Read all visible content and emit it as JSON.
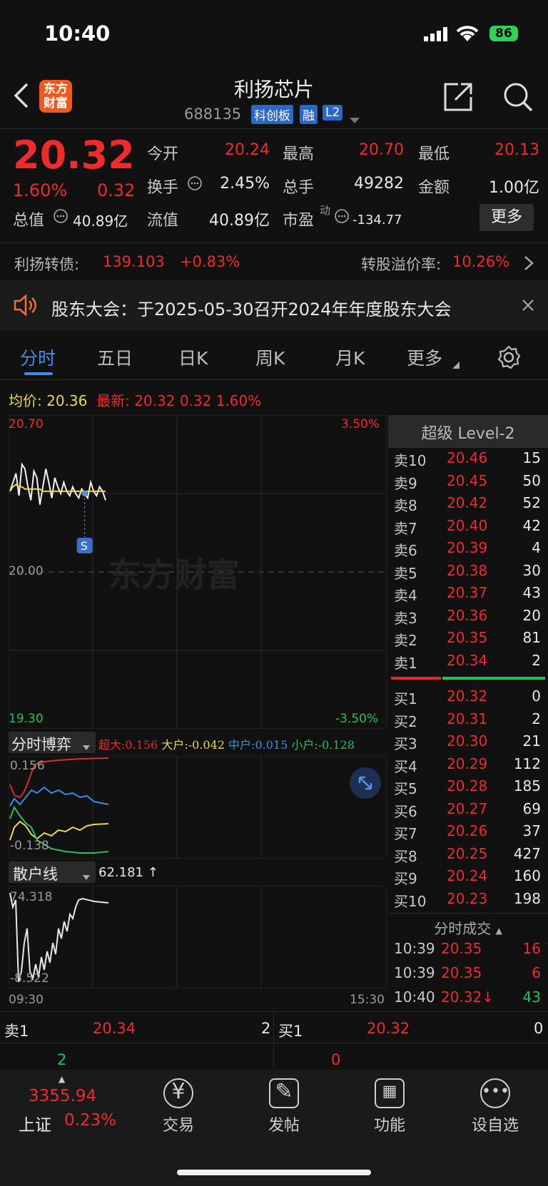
{
  "status_bar": {
    "time": "10:40",
    "battery": "86"
  },
  "header": {
    "logo_line1": "东方",
    "logo_line2": "财富",
    "title": "利扬芯片",
    "code": "688135",
    "tags": [
      "科创板",
      "融",
      "L2"
    ]
  },
  "quote": {
    "price": "20.32",
    "change_pct": "1.60%",
    "change": "0.32",
    "open_label": "今开",
    "open": "20.24",
    "high_label": "最高",
    "high": "20.70",
    "low_label": "最低",
    "low": "20.13",
    "turnover_label": "换手",
    "turnover": "2.45%",
    "volume_label": "总手",
    "volume": "49282",
    "amount_label": "金额",
    "amount": "1.00亿",
    "mktcap_label": "总值",
    "mktcap": "40.89亿",
    "float_label": "流值",
    "float": "40.89亿",
    "pe_label": "市盈",
    "pe_sup": "动",
    "pe": "-134.77",
    "more": "更多"
  },
  "bond": {
    "label": "利扬转债:",
    "price": "139.103",
    "change": "+0.83%",
    "premium_label": "转股溢价率:",
    "premium": "10.26%"
  },
  "notice": {
    "text": "股东大会：于2025-05-30召开2024年年度股东大会"
  },
  "tabs": [
    "分时",
    "五日",
    "日K",
    "周K",
    "月K",
    "更多"
  ],
  "chart_info": {
    "avg_label": "均价:",
    "avg": "20.36",
    "last_label": "最新:",
    "last": "20.32",
    "chg": "0.32",
    "pct": "1.60%"
  },
  "chart_data": [
    {
      "type": "line",
      "y_max_label": "20.70",
      "y_mid_label": "20.00",
      "y_min_label": "19.30",
      "pct_max_label": "3.50%",
      "pct_min_label": "-3.50%",
      "x_start": "09:30",
      "x_end": "15:30",
      "ylim": [
        19.3,
        20.7
      ],
      "series": [
        {
          "values": [
            20.36,
            20.4,
            20.44,
            20.34,
            20.48,
            20.46,
            20.38,
            20.32,
            20.45,
            20.42,
            20.3,
            20.38,
            20.46,
            20.4,
            20.33,
            20.42,
            20.38,
            20.35,
            20.4,
            20.36,
            20.34,
            20.38,
            20.35,
            20.33,
            20.37,
            20.35,
            20.33,
            20.4,
            20.36,
            20.34,
            20.38,
            20.36,
            20.32
          ]
        },
        {
          "values": [
            20.36,
            20.38,
            20.39,
            20.38,
            20.38,
            20.37,
            20.37,
            20.37,
            20.37,
            20.37,
            20.37,
            20.36,
            20.36,
            20.36,
            20.36,
            20.36,
            20.36,
            20.36,
            20.36,
            20.36,
            20.36,
            20.36,
            20.36,
            20.36,
            20.36,
            20.36,
            20.36,
            20.36,
            20.36,
            20.36,
            20.36,
            20.36,
            20.36
          ]
        }
      ],
      "marker": "S"
    }
  ],
  "game": {
    "title": "分时博弈",
    "super_label": "超大:",
    "super": "0.156",
    "big_label": "大户:",
    "big": "-0.042",
    "mid_label": "中户:",
    "mid": "0.015",
    "small_label": "小户:",
    "small": "-0.128",
    "y_max": "0.156",
    "y_min": "-0.138"
  },
  "retail": {
    "title": "散户线",
    "value": "62.181 ↑",
    "y_max": "74.318",
    "y_min": "-8.522"
  },
  "orderbook": {
    "title": "超级 Level-2",
    "asks": [
      {
        "label": "卖10",
        "price": "20.46",
        "vol": "15"
      },
      {
        "label": "卖9",
        "price": "20.45",
        "vol": "50"
      },
      {
        "label": "卖8",
        "price": "20.42",
        "vol": "52"
      },
      {
        "label": "卖7",
        "price": "20.40",
        "vol": "42"
      },
      {
        "label": "卖6",
        "price": "20.39",
        "vol": "4"
      },
      {
        "label": "卖5",
        "price": "20.38",
        "vol": "30"
      },
      {
        "label": "卖4",
        "price": "20.37",
        "vol": "43"
      },
      {
        "label": "卖3",
        "price": "20.36",
        "vol": "20"
      },
      {
        "label": "卖2",
        "price": "20.35",
        "vol": "81"
      },
      {
        "label": "卖1",
        "price": "20.34",
        "vol": "2"
      }
    ],
    "bids": [
      {
        "label": "买1",
        "price": "20.32",
        "vol": "0"
      },
      {
        "label": "买2",
        "price": "20.31",
        "vol": "2"
      },
      {
        "label": "买3",
        "price": "20.30",
        "vol": "21"
      },
      {
        "label": "买4",
        "price": "20.29",
        "vol": "112"
      },
      {
        "label": "买5",
        "price": "20.28",
        "vol": "185"
      },
      {
        "label": "买6",
        "price": "20.27",
        "vol": "69"
      },
      {
        "label": "买7",
        "price": "20.26",
        "vol": "37"
      },
      {
        "label": "买8",
        "price": "20.25",
        "vol": "427"
      },
      {
        "label": "买9",
        "price": "20.24",
        "vol": "160"
      },
      {
        "label": "买10",
        "price": "20.23",
        "vol": "198"
      }
    ],
    "trades_title": "分时成交",
    "trades": [
      {
        "time": "10:39",
        "price": "20.35",
        "vol": "16"
      },
      {
        "time": "10:39",
        "price": "20.35",
        "vol": "6"
      },
      {
        "time": "10:40",
        "price": "20.32↓",
        "vol": "43"
      }
    ]
  },
  "bottom_quote": {
    "ask_label": "卖1",
    "ask_price": "20.34",
    "ask_vol": "2",
    "ask_sub": "2",
    "bid_label": "买1",
    "bid_price": "20.32",
    "bid_vol": "0",
    "bid_sub": "0"
  },
  "index": {
    "value": "3355.94",
    "name": "上证",
    "pct": "0.23%"
  },
  "nav": [
    "交易",
    "发帖",
    "功能",
    "设自选"
  ],
  "watermark": "东方财富"
}
